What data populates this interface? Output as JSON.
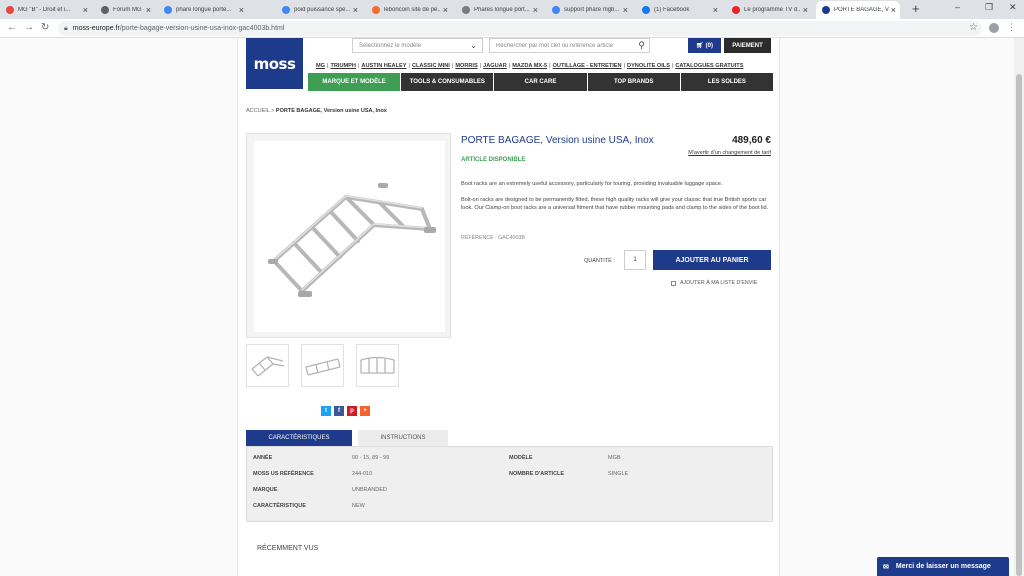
{
  "browser": {
    "tabs": [
      {
        "title": "MG \"B\" - Droit et i...",
        "favicon_color": "#e8453c"
      },
      {
        "title": "Forum MG - - MG ...",
        "favicon_color": "#5f6368"
      },
      {
        "title": "phare longue porte...",
        "favicon_color": "#4285f4"
      },
      {
        "title": "poid puissance spe...",
        "favicon_color": "#4285f4"
      },
      {
        "title": "leboncoin site de pe...",
        "favicon_color": "#f56b2a"
      },
      {
        "title": "Phares longue port...",
        "favicon_color": "#7a7a7a"
      },
      {
        "title": "support phare mgb...",
        "favicon_color": "#4285f4"
      },
      {
        "title": "(1) Facebook",
        "favicon_color": "#1877f2"
      },
      {
        "title": "Le programme TV d...",
        "favicon_color": "#e8232a"
      },
      {
        "title": "PORTE BAGAGE, Ve...",
        "favicon_color": "#1e3a8a"
      }
    ],
    "active_tab_index": 9,
    "new_tab_label": "+",
    "window_controls": {
      "minimize": "–",
      "maximize": "❐",
      "close": "✕"
    },
    "url_host": "moss-europe.fr",
    "url_path": "/porte-bagage-version-usine-usa-inox-gac4003b.html",
    "profile_initial": "f"
  },
  "header": {
    "logo_text": "moss",
    "model_select_placeholder": "Sélectionnez le modèle",
    "search_placeholder": "Rechercher par mot clef ou référence article",
    "cart_count": "(0)",
    "pay_label": "PAIEMENT",
    "brand_links": [
      "MG",
      "TRIUMPH",
      "AUSTIN HEALEY",
      "CLASSIC MINI",
      "MORRIS",
      "JAGUAR",
      "MAZDA MX-5",
      "OUTILLAGE - ENTRETIEN",
      "DYNOLITE OILS",
      "CATALOGUES GRATUITS"
    ],
    "nav": [
      "MARQUE ET MODÈLE",
      "TOOLS & CONSUMABLES",
      "CAR CARE",
      "TOP BRANDS",
      "LES SOLDES"
    ],
    "nav_active_index": 0
  },
  "breadcrumb": {
    "home": "ACCUEIL",
    "separator": ">",
    "current": "PORTE BAGAGE, Version usine USA, Inox"
  },
  "product": {
    "title": "PORTE BAGAGE, Version usine USA, Inox",
    "price": "489,60 €",
    "price_alert": "M'avertir d'un changement de tarif",
    "availability": "ARTICLE DISPONIBLE",
    "description_1": "Boot racks are an extremely useful accessory, particularly for touring, providing invaluable luggage space.",
    "description_2": "Bolt-on racks are designed to be permanently fitted, these high quality racks will give your classic that true British sports car look. Our Clamp-on boot racks are a universal fitment that have rubber mounting pads and clamp to the sides of the boot lid.",
    "reference": "RÉFÉRENCE : GAC4003B",
    "quantity_label": "QUANTITÉ :",
    "quantity_value": "1",
    "add_to_cart": "AJOUTER AU PANIER",
    "wishlist": "AJOUTER À MA LISTE D'ENVIE"
  },
  "share": [
    {
      "name": "twitter",
      "glyph": "t",
      "color": "#1da1f2"
    },
    {
      "name": "facebook",
      "glyph": "f",
      "color": "#3b5998"
    },
    {
      "name": "pinterest",
      "glyph": "p",
      "color": "#cb2027"
    },
    {
      "name": "more",
      "glyph": "+",
      "color": "#f5642c"
    }
  ],
  "detail_tabs": [
    "CARACTÉRISTIQUES",
    "INSTRUCTIONS"
  ],
  "detail_tabs_active_index": 0,
  "specs": {
    "left": [
      {
        "key": "ANNÉE",
        "value": "00 - 15, 89 - 99"
      },
      {
        "key": "MOSS US RÉFÉRENCE",
        "value": "244-010"
      },
      {
        "key": "MARQUE",
        "value": "UNBRANDED"
      },
      {
        "key": "CARACTÉRISTIQUE",
        "value": "NEW"
      }
    ],
    "right": [
      {
        "key": "MODÈLE",
        "value": "MGB"
      },
      {
        "key": "NOMBRE D'ARTICLE",
        "value": "SINGLE"
      }
    ]
  },
  "recently_viewed": "RÉCEMMENT VUS",
  "message_button": "Merci de laisser un message",
  "colors": {
    "brand_blue": "#1e3a8a",
    "accent_green": "#3e9e53",
    "nav_dark": "#333333"
  }
}
